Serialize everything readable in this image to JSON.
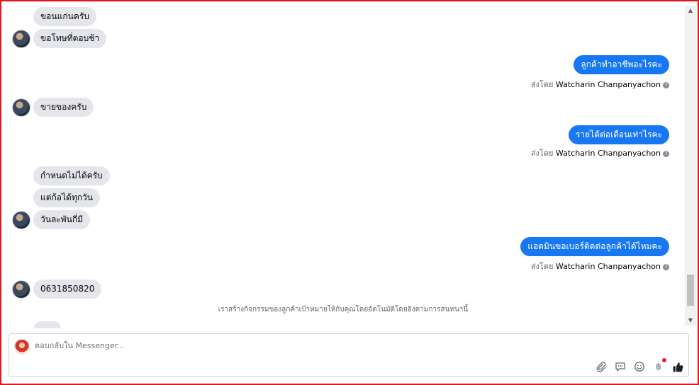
{
  "thread": {
    "incoming_1": "ขอนแก่นครับ",
    "incoming_2": "ขอโทษที่ตอบช้า",
    "outgoing_1": "ลูกค้าทำอาชีพอะไรคะ",
    "incoming_3": "ขายของครับ",
    "outgoing_2": "รายได้ต่อเดือนเท่าไรคะ",
    "incoming_4": "กำหนดไม่ได้ครับ",
    "incoming_5": "แต่ก้อได้ทุกวัน",
    "incoming_6": "วันละพันกี่มี",
    "outgoing_3": "แอดมินขอเบอร์ติดต่อลูกค้าได้ไหมคะ",
    "incoming_7": "0631850820",
    "sent_by_prefix": "ส่งโดย",
    "sent_by_name": "Watcharin Chanpanyachon",
    "help_mark": "?",
    "notice": "เราสร้างกิจกรรมของลูกค้าเป้าหมายให้กับคุณโดยอัตโนมัติโดยอิงตามการสนทนานี้"
  },
  "composer": {
    "placeholder": "ตอบกลับใน Messenger...",
    "tools": [
      "paperclip-icon",
      "chat-bubble-icon",
      "smiley-icon",
      "baht-icon",
      "thumbs-up-icon"
    ],
    "baht_symbol": "฿"
  },
  "colors": {
    "outgoing_bubble": "#1877f2",
    "incoming_bubble": "#e4e6eb",
    "frame_border": "#e0141c",
    "notification_dot": "#e41e3f"
  }
}
